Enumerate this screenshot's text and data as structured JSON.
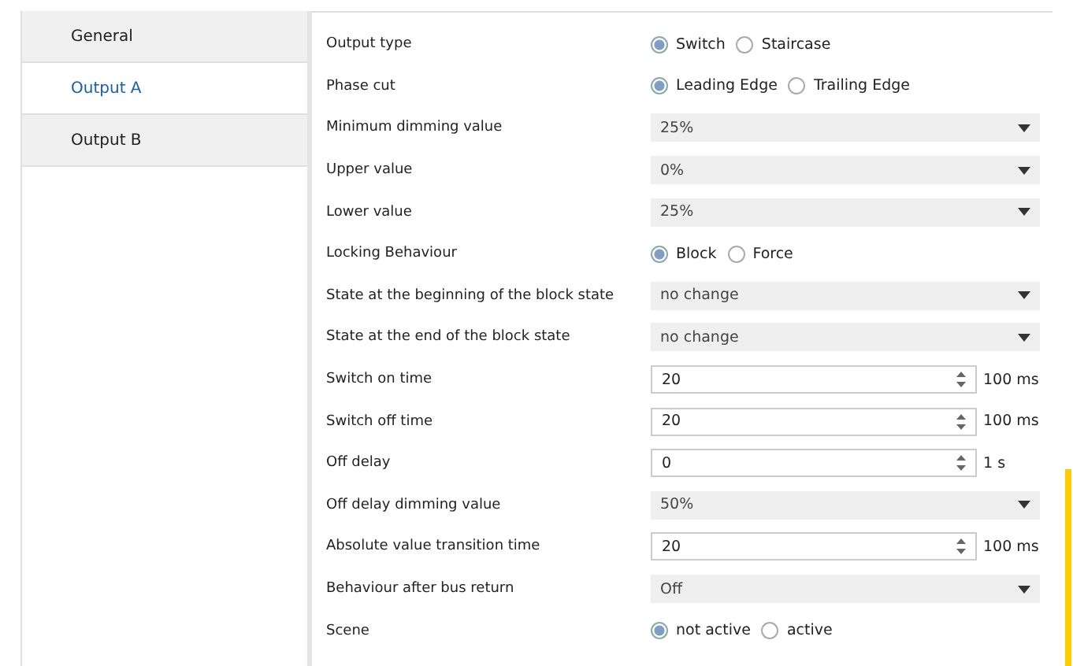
{
  "sidebar": {
    "items": [
      {
        "label": "General",
        "selected": false
      },
      {
        "label": "Output A",
        "selected": true
      },
      {
        "label": "Output B",
        "selected": false
      }
    ]
  },
  "parameters": [
    {
      "label": "Output type",
      "kind": "radio",
      "options": [
        {
          "label": "Switch",
          "selected": true
        },
        {
          "label": "Staircase",
          "selected": false
        }
      ]
    },
    {
      "label": "Phase cut",
      "kind": "radio",
      "options": [
        {
          "label": "Leading Edge",
          "selected": true
        },
        {
          "label": "Trailing Edge",
          "selected": false
        }
      ]
    },
    {
      "label": "Minimum dimming value",
      "kind": "select",
      "value": "25%"
    },
    {
      "label": "Upper value",
      "kind": "select",
      "value": "0%"
    },
    {
      "label": "Lower value",
      "kind": "select",
      "value": "25%"
    },
    {
      "label": "Locking Behaviour",
      "kind": "radio",
      "options": [
        {
          "label": "Block",
          "selected": true
        },
        {
          "label": "Force",
          "selected": false
        }
      ]
    },
    {
      "label": "State at the beginning of the block state",
      "kind": "select",
      "value": "no change"
    },
    {
      "label": "State at the end of the block state",
      "kind": "select",
      "value": "no change"
    },
    {
      "label": "Switch on time",
      "kind": "spin",
      "value": "20",
      "unit": "100 ms"
    },
    {
      "label": "Switch off time",
      "kind": "spin",
      "value": "20",
      "unit": "100 ms"
    },
    {
      "label": "Off delay",
      "kind": "spin",
      "value": "0",
      "unit": "1 s"
    },
    {
      "label": "Off delay dimming value",
      "kind": "select",
      "value": "50%"
    },
    {
      "label": "Absolute value transition time",
      "kind": "spin",
      "value": "20",
      "unit": "100 ms"
    },
    {
      "label": "Behaviour after bus return",
      "kind": "select",
      "value": "Off"
    },
    {
      "label": "Scene",
      "kind": "radio",
      "options": [
        {
          "label": "not active",
          "selected": true
        },
        {
          "label": "active",
          "selected": false
        }
      ]
    }
  ]
}
